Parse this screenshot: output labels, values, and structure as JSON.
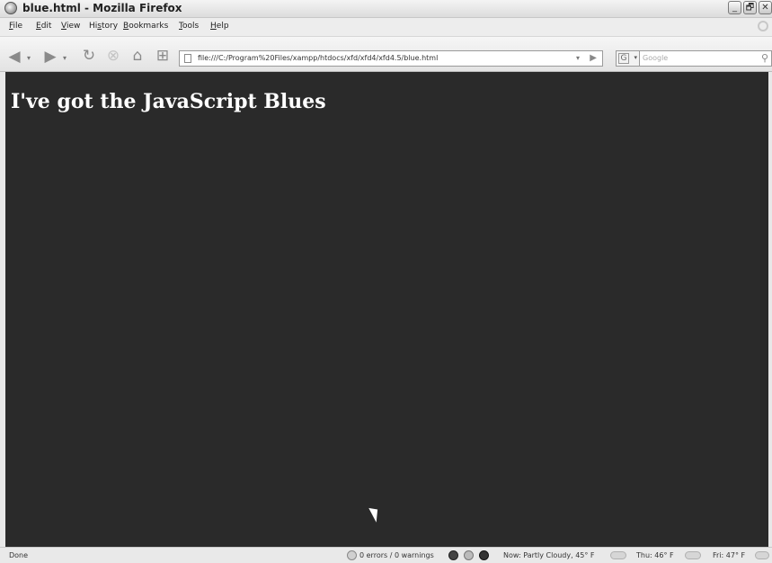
{
  "window": {
    "title": "blue.html - Mozilla Firefox",
    "buttons": [
      "_",
      "🗗",
      "✕"
    ]
  },
  "menu": {
    "file": {
      "ul": "F",
      "rest": "ile"
    },
    "edit": {
      "ul": "E",
      "rest": "dit"
    },
    "view": {
      "ul": "V",
      "rest": "iew"
    },
    "history": {
      "pre": "Hi",
      "ul": "s",
      "rest": "tory"
    },
    "bookmarks": {
      "ul": "B",
      "rest": "ookmarks"
    },
    "tools": {
      "ul": "T",
      "rest": "ools"
    },
    "help": {
      "ul": "H",
      "rest": "elp"
    }
  },
  "toolbar": {
    "url": "file:///C:/Program%20Files/xampp/htdocs/xfd/xfd4/xfd4.5/blue.html",
    "search_placeholder": "Google",
    "search_engine_glyph": "G"
  },
  "page": {
    "heading": "I've got the JavaScript Blues",
    "background_color": "#2a2a2a",
    "heading_color": "#ffffff"
  },
  "status": {
    "left": "Done",
    "errors": "0 errors / 0 warnings",
    "weather_now": "Now: Partly Cloudy, 45° F",
    "weather_thu": "Thu: 46° F",
    "weather_fri": "Fri: 47° F"
  }
}
